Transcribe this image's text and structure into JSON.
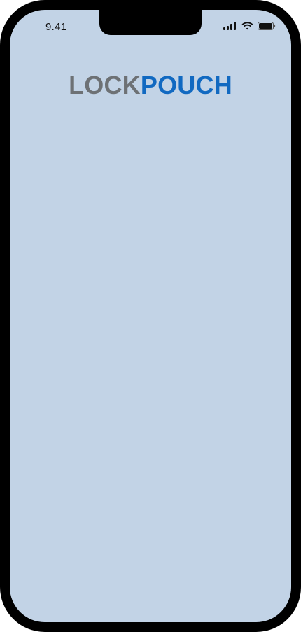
{
  "status_bar": {
    "time": "9.41",
    "icons": [
      "signal-icon",
      "wifi-icon",
      "battery-icon"
    ]
  },
  "logo": {
    "part1": "LOCK",
    "part2": "POUCH"
  },
  "colors": {
    "screen_background": "#c2d3e6",
    "device_frame": "#000000",
    "logo_gray": "#6d7175",
    "logo_blue": "#1169c1"
  }
}
